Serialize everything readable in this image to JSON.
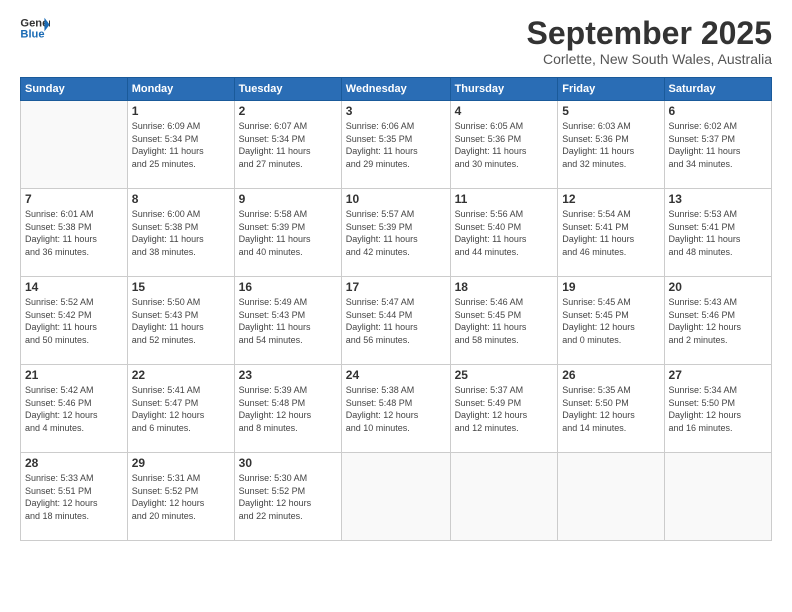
{
  "header": {
    "logo_line1": "General",
    "logo_line2": "Blue",
    "month_title": "September 2025",
    "location": "Corlette, New South Wales, Australia"
  },
  "weekdays": [
    "Sunday",
    "Monday",
    "Tuesday",
    "Wednesday",
    "Thursday",
    "Friday",
    "Saturday"
  ],
  "weeks": [
    [
      {
        "day": "",
        "info": ""
      },
      {
        "day": "1",
        "info": "Sunrise: 6:09 AM\nSunset: 5:34 PM\nDaylight: 11 hours\nand 25 minutes."
      },
      {
        "day": "2",
        "info": "Sunrise: 6:07 AM\nSunset: 5:34 PM\nDaylight: 11 hours\nand 27 minutes."
      },
      {
        "day": "3",
        "info": "Sunrise: 6:06 AM\nSunset: 5:35 PM\nDaylight: 11 hours\nand 29 minutes."
      },
      {
        "day": "4",
        "info": "Sunrise: 6:05 AM\nSunset: 5:36 PM\nDaylight: 11 hours\nand 30 minutes."
      },
      {
        "day": "5",
        "info": "Sunrise: 6:03 AM\nSunset: 5:36 PM\nDaylight: 11 hours\nand 32 minutes."
      },
      {
        "day": "6",
        "info": "Sunrise: 6:02 AM\nSunset: 5:37 PM\nDaylight: 11 hours\nand 34 minutes."
      }
    ],
    [
      {
        "day": "7",
        "info": "Sunrise: 6:01 AM\nSunset: 5:38 PM\nDaylight: 11 hours\nand 36 minutes."
      },
      {
        "day": "8",
        "info": "Sunrise: 6:00 AM\nSunset: 5:38 PM\nDaylight: 11 hours\nand 38 minutes."
      },
      {
        "day": "9",
        "info": "Sunrise: 5:58 AM\nSunset: 5:39 PM\nDaylight: 11 hours\nand 40 minutes."
      },
      {
        "day": "10",
        "info": "Sunrise: 5:57 AM\nSunset: 5:39 PM\nDaylight: 11 hours\nand 42 minutes."
      },
      {
        "day": "11",
        "info": "Sunrise: 5:56 AM\nSunset: 5:40 PM\nDaylight: 11 hours\nand 44 minutes."
      },
      {
        "day": "12",
        "info": "Sunrise: 5:54 AM\nSunset: 5:41 PM\nDaylight: 11 hours\nand 46 minutes."
      },
      {
        "day": "13",
        "info": "Sunrise: 5:53 AM\nSunset: 5:41 PM\nDaylight: 11 hours\nand 48 minutes."
      }
    ],
    [
      {
        "day": "14",
        "info": "Sunrise: 5:52 AM\nSunset: 5:42 PM\nDaylight: 11 hours\nand 50 minutes."
      },
      {
        "day": "15",
        "info": "Sunrise: 5:50 AM\nSunset: 5:43 PM\nDaylight: 11 hours\nand 52 minutes."
      },
      {
        "day": "16",
        "info": "Sunrise: 5:49 AM\nSunset: 5:43 PM\nDaylight: 11 hours\nand 54 minutes."
      },
      {
        "day": "17",
        "info": "Sunrise: 5:47 AM\nSunset: 5:44 PM\nDaylight: 11 hours\nand 56 minutes."
      },
      {
        "day": "18",
        "info": "Sunrise: 5:46 AM\nSunset: 5:45 PM\nDaylight: 11 hours\nand 58 minutes."
      },
      {
        "day": "19",
        "info": "Sunrise: 5:45 AM\nSunset: 5:45 PM\nDaylight: 12 hours\nand 0 minutes."
      },
      {
        "day": "20",
        "info": "Sunrise: 5:43 AM\nSunset: 5:46 PM\nDaylight: 12 hours\nand 2 minutes."
      }
    ],
    [
      {
        "day": "21",
        "info": "Sunrise: 5:42 AM\nSunset: 5:46 PM\nDaylight: 12 hours\nand 4 minutes."
      },
      {
        "day": "22",
        "info": "Sunrise: 5:41 AM\nSunset: 5:47 PM\nDaylight: 12 hours\nand 6 minutes."
      },
      {
        "day": "23",
        "info": "Sunrise: 5:39 AM\nSunset: 5:48 PM\nDaylight: 12 hours\nand 8 minutes."
      },
      {
        "day": "24",
        "info": "Sunrise: 5:38 AM\nSunset: 5:48 PM\nDaylight: 12 hours\nand 10 minutes."
      },
      {
        "day": "25",
        "info": "Sunrise: 5:37 AM\nSunset: 5:49 PM\nDaylight: 12 hours\nand 12 minutes."
      },
      {
        "day": "26",
        "info": "Sunrise: 5:35 AM\nSunset: 5:50 PM\nDaylight: 12 hours\nand 14 minutes."
      },
      {
        "day": "27",
        "info": "Sunrise: 5:34 AM\nSunset: 5:50 PM\nDaylight: 12 hours\nand 16 minutes."
      }
    ],
    [
      {
        "day": "28",
        "info": "Sunrise: 5:33 AM\nSunset: 5:51 PM\nDaylight: 12 hours\nand 18 minutes."
      },
      {
        "day": "29",
        "info": "Sunrise: 5:31 AM\nSunset: 5:52 PM\nDaylight: 12 hours\nand 20 minutes."
      },
      {
        "day": "30",
        "info": "Sunrise: 5:30 AM\nSunset: 5:52 PM\nDaylight: 12 hours\nand 22 minutes."
      },
      {
        "day": "",
        "info": ""
      },
      {
        "day": "",
        "info": ""
      },
      {
        "day": "",
        "info": ""
      },
      {
        "day": "",
        "info": ""
      }
    ]
  ]
}
